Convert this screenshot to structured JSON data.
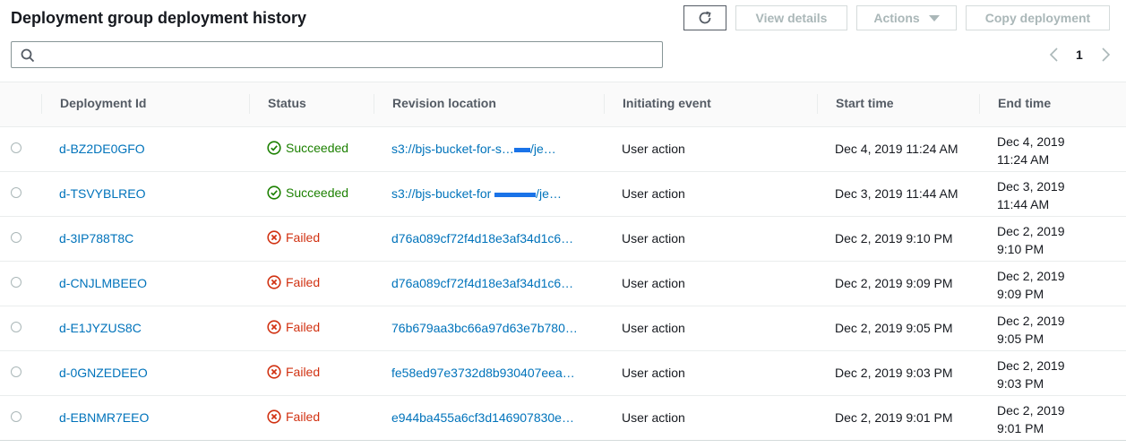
{
  "header": {
    "title": "Deployment group deployment history",
    "buttons": {
      "view_details": "View details",
      "actions": "Actions",
      "copy_deployment": "Copy deployment"
    }
  },
  "search": {
    "placeholder": ""
  },
  "pagination": {
    "current_page": "1"
  },
  "columns": [
    "Deployment Id",
    "Status",
    "Revision location",
    "Initiating event",
    "Start time",
    "End time"
  ],
  "rows": [
    {
      "id": "d-BZ2DE0GFO",
      "status": "Succeeded",
      "status_type": "success",
      "revision": "s3://bjs-bucket-for-s…",
      "revision_suffix": "/je…",
      "event": "User action",
      "start": "Dec 4, 2019 11:24 AM",
      "end_date": "Dec 4, 2019",
      "end_time": "11:24 AM"
    },
    {
      "id": "d-TSVYBLREO",
      "status": "Succeeded",
      "status_type": "success",
      "revision": "s3://bjs-bucket-for ",
      "revision_suffix": "/je…",
      "event": "User action",
      "start": "Dec 3, 2019 11:44 AM",
      "end_date": "Dec 3, 2019",
      "end_time": "11:44 AM"
    },
    {
      "id": "d-3IP788T8C",
      "status": "Failed",
      "status_type": "error",
      "revision": "d76a089cf72f4d18e3af34d1c6…",
      "revision_suffix": "",
      "event": "User action",
      "start": "Dec 2, 2019 9:10 PM",
      "end_date": "Dec 2, 2019",
      "end_time": "9:10 PM"
    },
    {
      "id": "d-CNJLMBEEO",
      "status": "Failed",
      "status_type": "error",
      "revision": "d76a089cf72f4d18e3af34d1c6…",
      "revision_suffix": "",
      "event": "User action",
      "start": "Dec 2, 2019 9:09 PM",
      "end_date": "Dec 2, 2019",
      "end_time": "9:09 PM"
    },
    {
      "id": "d-E1JYZUS8C",
      "status": "Failed",
      "status_type": "error",
      "revision": "76b679aa3bc66a97d63e7b780…",
      "revision_suffix": "",
      "event": "User action",
      "start": "Dec 2, 2019 9:05 PM",
      "end_date": "Dec 2, 2019",
      "end_time": "9:05 PM"
    },
    {
      "id": "d-0GNZEDEEO",
      "status": "Failed",
      "status_type": "error",
      "revision": "fe58ed97e3732d8b930407eea…",
      "revision_suffix": "",
      "event": "User action",
      "start": "Dec 2, 2019 9:03 PM",
      "end_date": "Dec 2, 2019",
      "end_time": "9:03 PM"
    },
    {
      "id": "d-EBNMR7EEO",
      "status": "Failed",
      "status_type": "error",
      "revision": "e944ba455a6cf3d146907830e…",
      "revision_suffix": "",
      "event": "User action",
      "start": "Dec 2, 2019 9:01 PM",
      "end_date": "Dec 2, 2019",
      "end_time": "9:01 PM"
    }
  ],
  "colors": {
    "link": "#0073bb",
    "success": "#1d8102",
    "error": "#d13212"
  },
  "icons": {
    "refresh": "refresh-icon",
    "search": "search-icon",
    "success": "check-circle-icon",
    "error": "x-circle-icon"
  }
}
